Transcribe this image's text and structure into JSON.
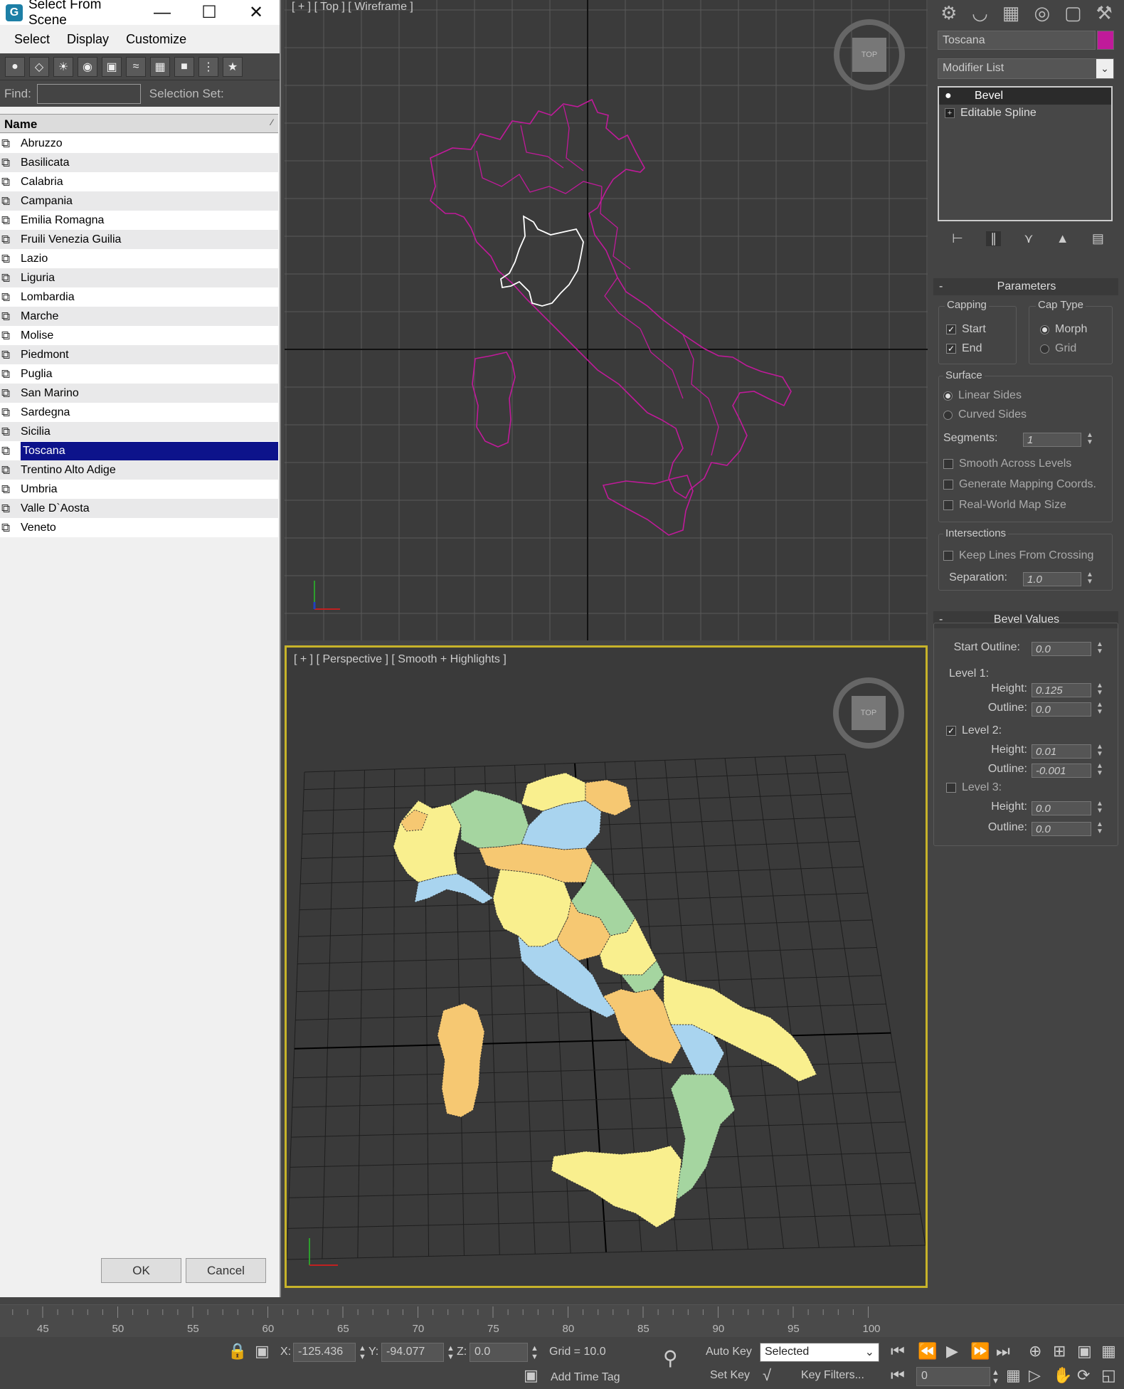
{
  "dialog": {
    "title": "Select From Scene",
    "menu": [
      "Select",
      "Display",
      "Customize"
    ],
    "find_label": "Find:",
    "find_value": "",
    "selection_set_label": "Selection Set:",
    "column_header": "Name",
    "items": [
      "Abruzzo",
      "Basilicata",
      "Calabria",
      "Campania",
      "Emilia Romagna",
      "Fruili Venezia Guilia",
      "Lazio",
      "Liguria",
      "Lombardia",
      "Marche",
      "Molise",
      "Piedmont",
      "Puglia",
      "San Marino",
      "Sardegna",
      "Sicilia",
      "Toscana",
      "Trentino Alto Adige",
      "Umbria",
      "Valle D`Aosta",
      "Veneto"
    ],
    "selected_item": "Toscana",
    "ok_label": "OK",
    "cancel_label": "Cancel"
  },
  "viewports": {
    "top_label": "[ + ] [ Top ] [ Wireframe ]",
    "persp_label": "[ + ] [ Perspective ] [ Smooth + Highlights ]",
    "cube_top_text": "TOP"
  },
  "command_panel": {
    "object_name": "Toscana",
    "object_color": "#c01a9a",
    "modifier_list_label": "Modifier List",
    "stack": [
      "Bevel",
      "Editable Spline"
    ],
    "parameters": {
      "title": "Parameters",
      "capping_label": "Capping",
      "start_label": "Start",
      "end_label": "End",
      "cap_type_label": "Cap Type",
      "morph_label": "Morph",
      "grid_label": "Grid",
      "surface_label": "Surface",
      "linear_sides": "Linear Sides",
      "curved_sides": "Curved Sides",
      "segments_label": "Segments:",
      "segments_value": "1",
      "smooth_across": "Smooth Across Levels",
      "gen_mapping": "Generate Mapping Coords.",
      "real_world": "Real-World Map Size",
      "intersections_label": "Intersections",
      "keep_lines": "Keep Lines From Crossing",
      "separation_label": "Separation:",
      "separation_value": "1.0"
    },
    "bevel_values": {
      "title": "Bevel Values",
      "start_outline_label": "Start Outline:",
      "start_outline_value": "0.0",
      "level1_label": "Level 1:",
      "level1_height": "0.125",
      "level1_outline": "0.0",
      "level2_label": "Level 2:",
      "level2_height": "0.01",
      "level2_outline": "-0.001",
      "level3_label": "Level 3:",
      "level3_height": "0.0",
      "level3_outline": "0.0",
      "height_label": "Height:",
      "outline_label": "Outline:"
    }
  },
  "timeline": {
    "ticks": [
      "45",
      "50",
      "55",
      "60",
      "65",
      "70",
      "75",
      "80",
      "85",
      "90",
      "95",
      "100"
    ]
  },
  "status": {
    "x_label": "X:",
    "x_value": "-125.436",
    "y_label": "Y:",
    "y_value": "-94.077",
    "z_label": "Z:",
    "z_value": "0.0",
    "grid": "Grid = 10.0",
    "add_time_tag": "Add Time Tag",
    "auto_key": "Auto Key",
    "set_key": "Set Key",
    "selected": "Selected",
    "key_filters": "Key Filters...",
    "frame": "0"
  },
  "colors": {
    "selection_bg": "#0d138b",
    "wireframe_pink": "#c01a9a",
    "active_viewport_border": "#c7b32a",
    "region_yellow": "#f9ef8e",
    "region_orange": "#f6c872",
    "region_blue": "#a9d4ef",
    "region_green": "#a5d5a0"
  }
}
